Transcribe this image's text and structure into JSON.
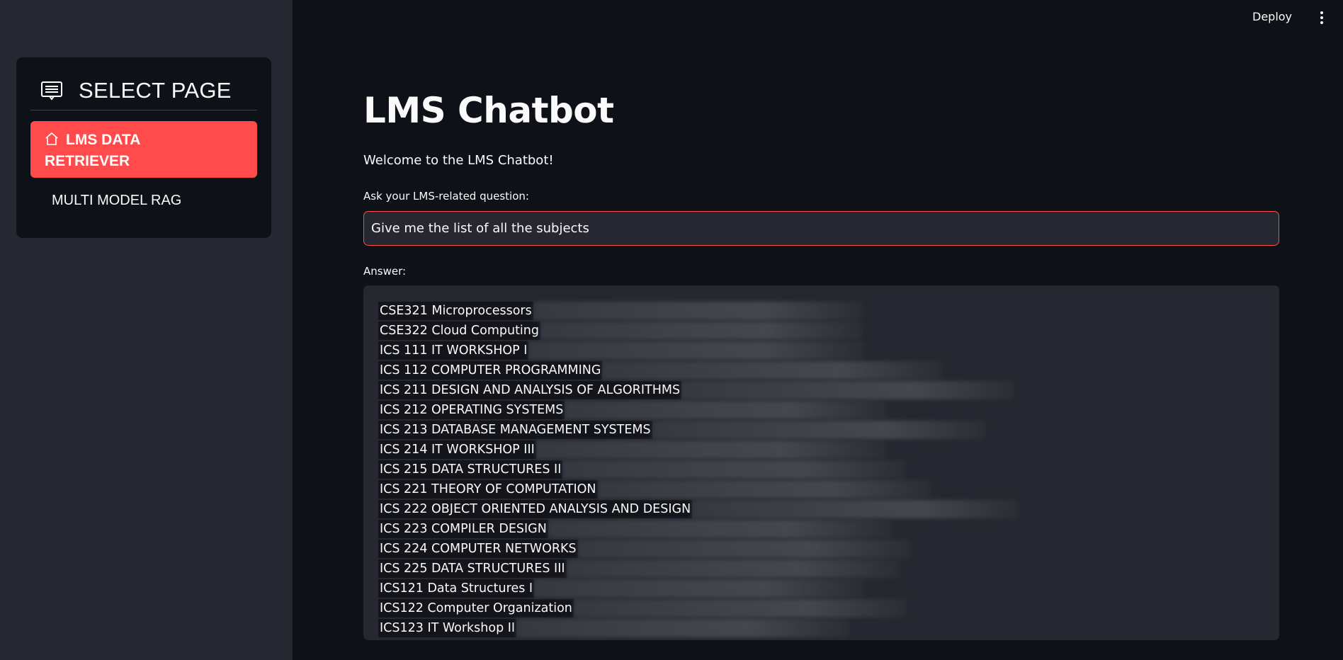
{
  "topbar": {
    "deploy_label": "Deploy",
    "menu_icon": "kebab-menu-icon"
  },
  "sidebar": {
    "menu_icon": "page-list-icon",
    "title": "SELECT PAGE",
    "items": [
      {
        "label_line1": "LMS DATA",
        "label_line2": "RETRIEVER",
        "icon": "home-icon",
        "active": true
      },
      {
        "label": "MULTI MODEL RAG",
        "active": false
      }
    ]
  },
  "main": {
    "title": "LMS Chatbot",
    "welcome": "Welcome to the LMS Chatbot!",
    "question_label": "Ask your LMS-related question:",
    "question_value": "Give me the list of all the subjects",
    "answer_label": "Answer:",
    "answer_lines": [
      "CSE321 Microprocessors",
      "CSE322 Cloud Computing",
      "ICS 111 IT WORKSHOP I",
      "ICS 112 COMPUTER PROGRAMMING",
      "ICS 211 DESIGN AND ANALYSIS OF ALGORITHMS",
      "ICS 212 OPERATING SYSTEMS",
      "ICS 213 DATABASE MANAGEMENT SYSTEMS",
      "ICS 214 IT WORKSHOP III",
      "ICS 215 DATA STRUCTURES II",
      "ICS 221 THEORY OF COMPUTATION",
      "ICS 222 OBJECT ORIENTED ANALYSIS AND DESIGN",
      "ICS 223 COMPILER DESIGN",
      "ICS 224 COMPUTER NETWORKS",
      "ICS 225 DATA STRUCTURES III",
      "ICS121 Data Structures I",
      "ICS122 Computer Organization",
      "ICS123 IT Workshop II"
    ]
  },
  "colors": {
    "background": "#0e1117",
    "sidebar": "#262730",
    "accent": "#ff4b4b",
    "text": "#fafafa"
  }
}
